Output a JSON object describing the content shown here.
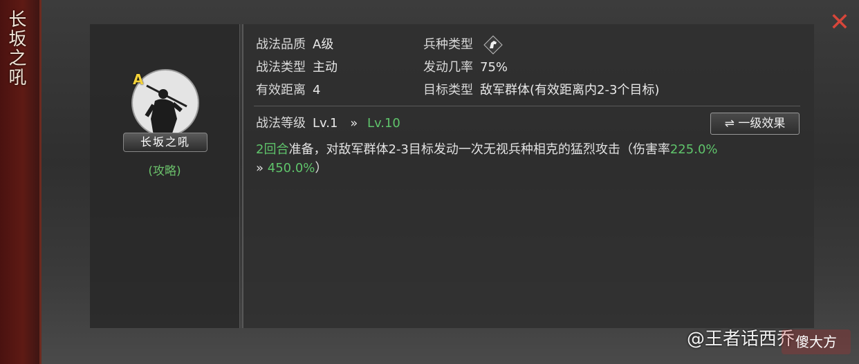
{
  "side_title": "长坂之吼",
  "close_icon": "close-x-icon",
  "skill": {
    "grade_badge": "A",
    "plate_name": "长坂之吼",
    "strategy_link": "(攻略)"
  },
  "info": {
    "quality_label": "战法品质",
    "quality_value": "A级",
    "type_label": "战法类型",
    "type_value": "主动",
    "range_label": "有效距离",
    "range_value": "4",
    "unit_label": "兵种类型",
    "unit_icon": "cavalry-horse-icon",
    "rate_label": "发动几率",
    "rate_value": "75%",
    "target_label": "目标类型",
    "target_value": "敌军群体(有效距离内2-3个目标)"
  },
  "level": {
    "label": "战法等级",
    "current": "Lv.1",
    "arrow": "»",
    "max": "Lv.10",
    "effect_button": "⇌ 一级效果"
  },
  "description": {
    "prep_turns": "2回合",
    "text_main": "准备，对敌军群体2-3目标发动一次无视兵种相克的猛烈攻击（伤害率",
    "rate_from": "225.0%",
    "arrow": "»",
    "rate_to": "450.0%",
    "close_paren": "）"
  },
  "watermark": {
    "text": "@王者话西乔",
    "logo": "傻大方"
  },
  "colors": {
    "accent_green": "#5fc46b",
    "close_red": "#d7463a",
    "grade_gold": "#f3d23a"
  }
}
